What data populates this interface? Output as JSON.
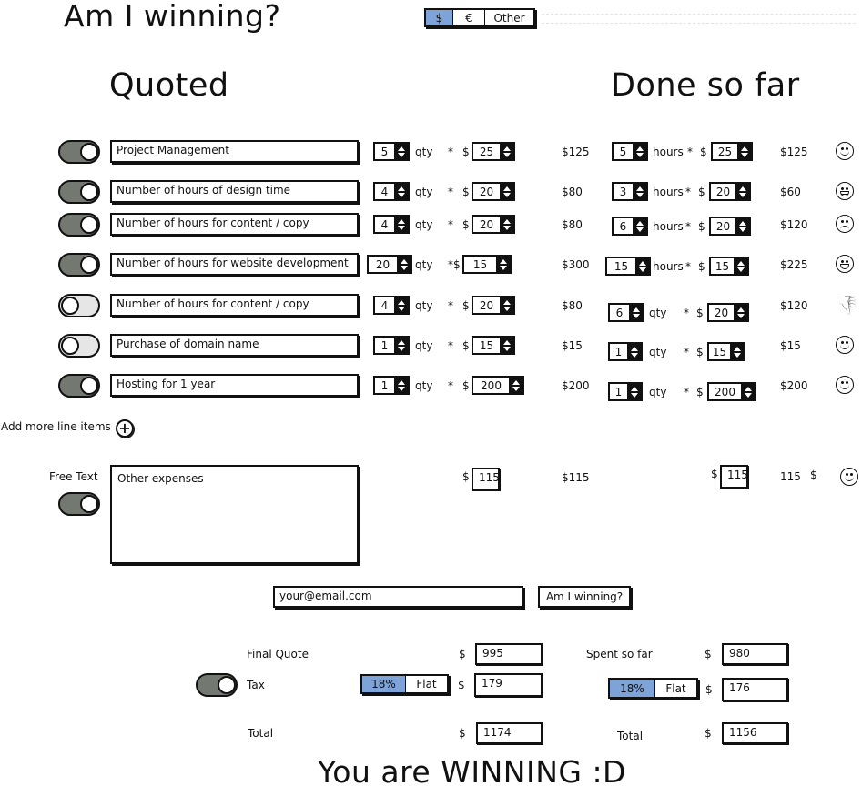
{
  "header": {
    "title": "Am I winning?",
    "currency": {
      "options": [
        "$",
        "€",
        "Other"
      ],
      "selected": "$"
    }
  },
  "columns": {
    "quoted": "Quoted",
    "done": "Done so far"
  },
  "rows": [
    {
      "label": "Project Management",
      "q_qty": "5",
      "q_unit": "qty",
      "q_rate": "25",
      "q_total": "$125",
      "d_qty": "5",
      "d_unit": "hours",
      "d_rate": "25",
      "d_total": "$125",
      "mood": "smile",
      "toggle": true
    },
    {
      "label": "Number of hours of design time",
      "q_qty": "4",
      "q_unit": "qty",
      "q_rate": "20",
      "q_total": "$80",
      "d_qty": "3",
      "d_unit": "hours",
      "d_rate": "20",
      "d_total": "$60",
      "mood": "grin",
      "toggle": true
    },
    {
      "label": "Number of hours for content / copy",
      "q_qty": "4",
      "q_unit": "qty",
      "q_rate": "20",
      "q_total": "$80",
      "d_qty": "6",
      "d_unit": "hours",
      "d_rate": "20",
      "d_total": "$120",
      "mood": "frown",
      "toggle": true
    },
    {
      "label": "Number of hours for website development",
      "q_qty": "20",
      "q_unit": "qty",
      "q_rate": "15",
      "q_total": "$300",
      "d_qty": "15",
      "d_unit": "hours",
      "d_rate": "15",
      "d_total": "$225",
      "mood": "grin",
      "toggle": true
    },
    {
      "label": "Number of hours for content / copy",
      "q_qty": "4",
      "q_unit": "qty",
      "q_rate": "20",
      "q_total": "$80",
      "d_qty": "6",
      "d_unit": "qty",
      "d_rate": "20",
      "d_total": "$120",
      "mood": "thumbs-down",
      "toggle": false
    },
    {
      "label": "Purchase of domain name",
      "q_qty": "1",
      "q_unit": "qty",
      "q_rate": "15",
      "q_total": "$15",
      "d_qty": "1",
      "d_unit": "qty",
      "d_rate": "15",
      "d_total": "$15",
      "mood": "smile",
      "toggle": false
    },
    {
      "label": "Hosting for 1 year",
      "q_qty": "1",
      "q_unit": "qty",
      "q_rate": "200",
      "q_total": "$200",
      "d_qty": "1",
      "d_unit": "qty",
      "d_rate": "200",
      "d_total": "$200",
      "mood": "smile",
      "toggle": true
    }
  ],
  "symbols": {
    "times": "*",
    "dollar": "$"
  },
  "add_more": "Add more line items",
  "free_text": {
    "label": "Free Text",
    "content": "Other expenses",
    "quoted_amount": "115",
    "quoted_total": "$115",
    "done_amount": "115",
    "done_total": "115",
    "done_total_symbol": "$",
    "toggle": true
  },
  "email": {
    "value": "your@email.com",
    "button": "Am I winning?"
  },
  "summary": {
    "final_quote_label": "Final Quote",
    "final_quote": "995",
    "spent_label": "Spent so far",
    "spent": "980",
    "tax_label": "Tax",
    "tax_toggle": true,
    "tax_options": [
      "18%",
      "Flat"
    ],
    "tax_selected": "18%",
    "tax_quoted": "179",
    "tax_done": "176",
    "total_label": "Total",
    "total_quoted": "1174",
    "total_done": "1156"
  },
  "result": "You are WINNING :D"
}
